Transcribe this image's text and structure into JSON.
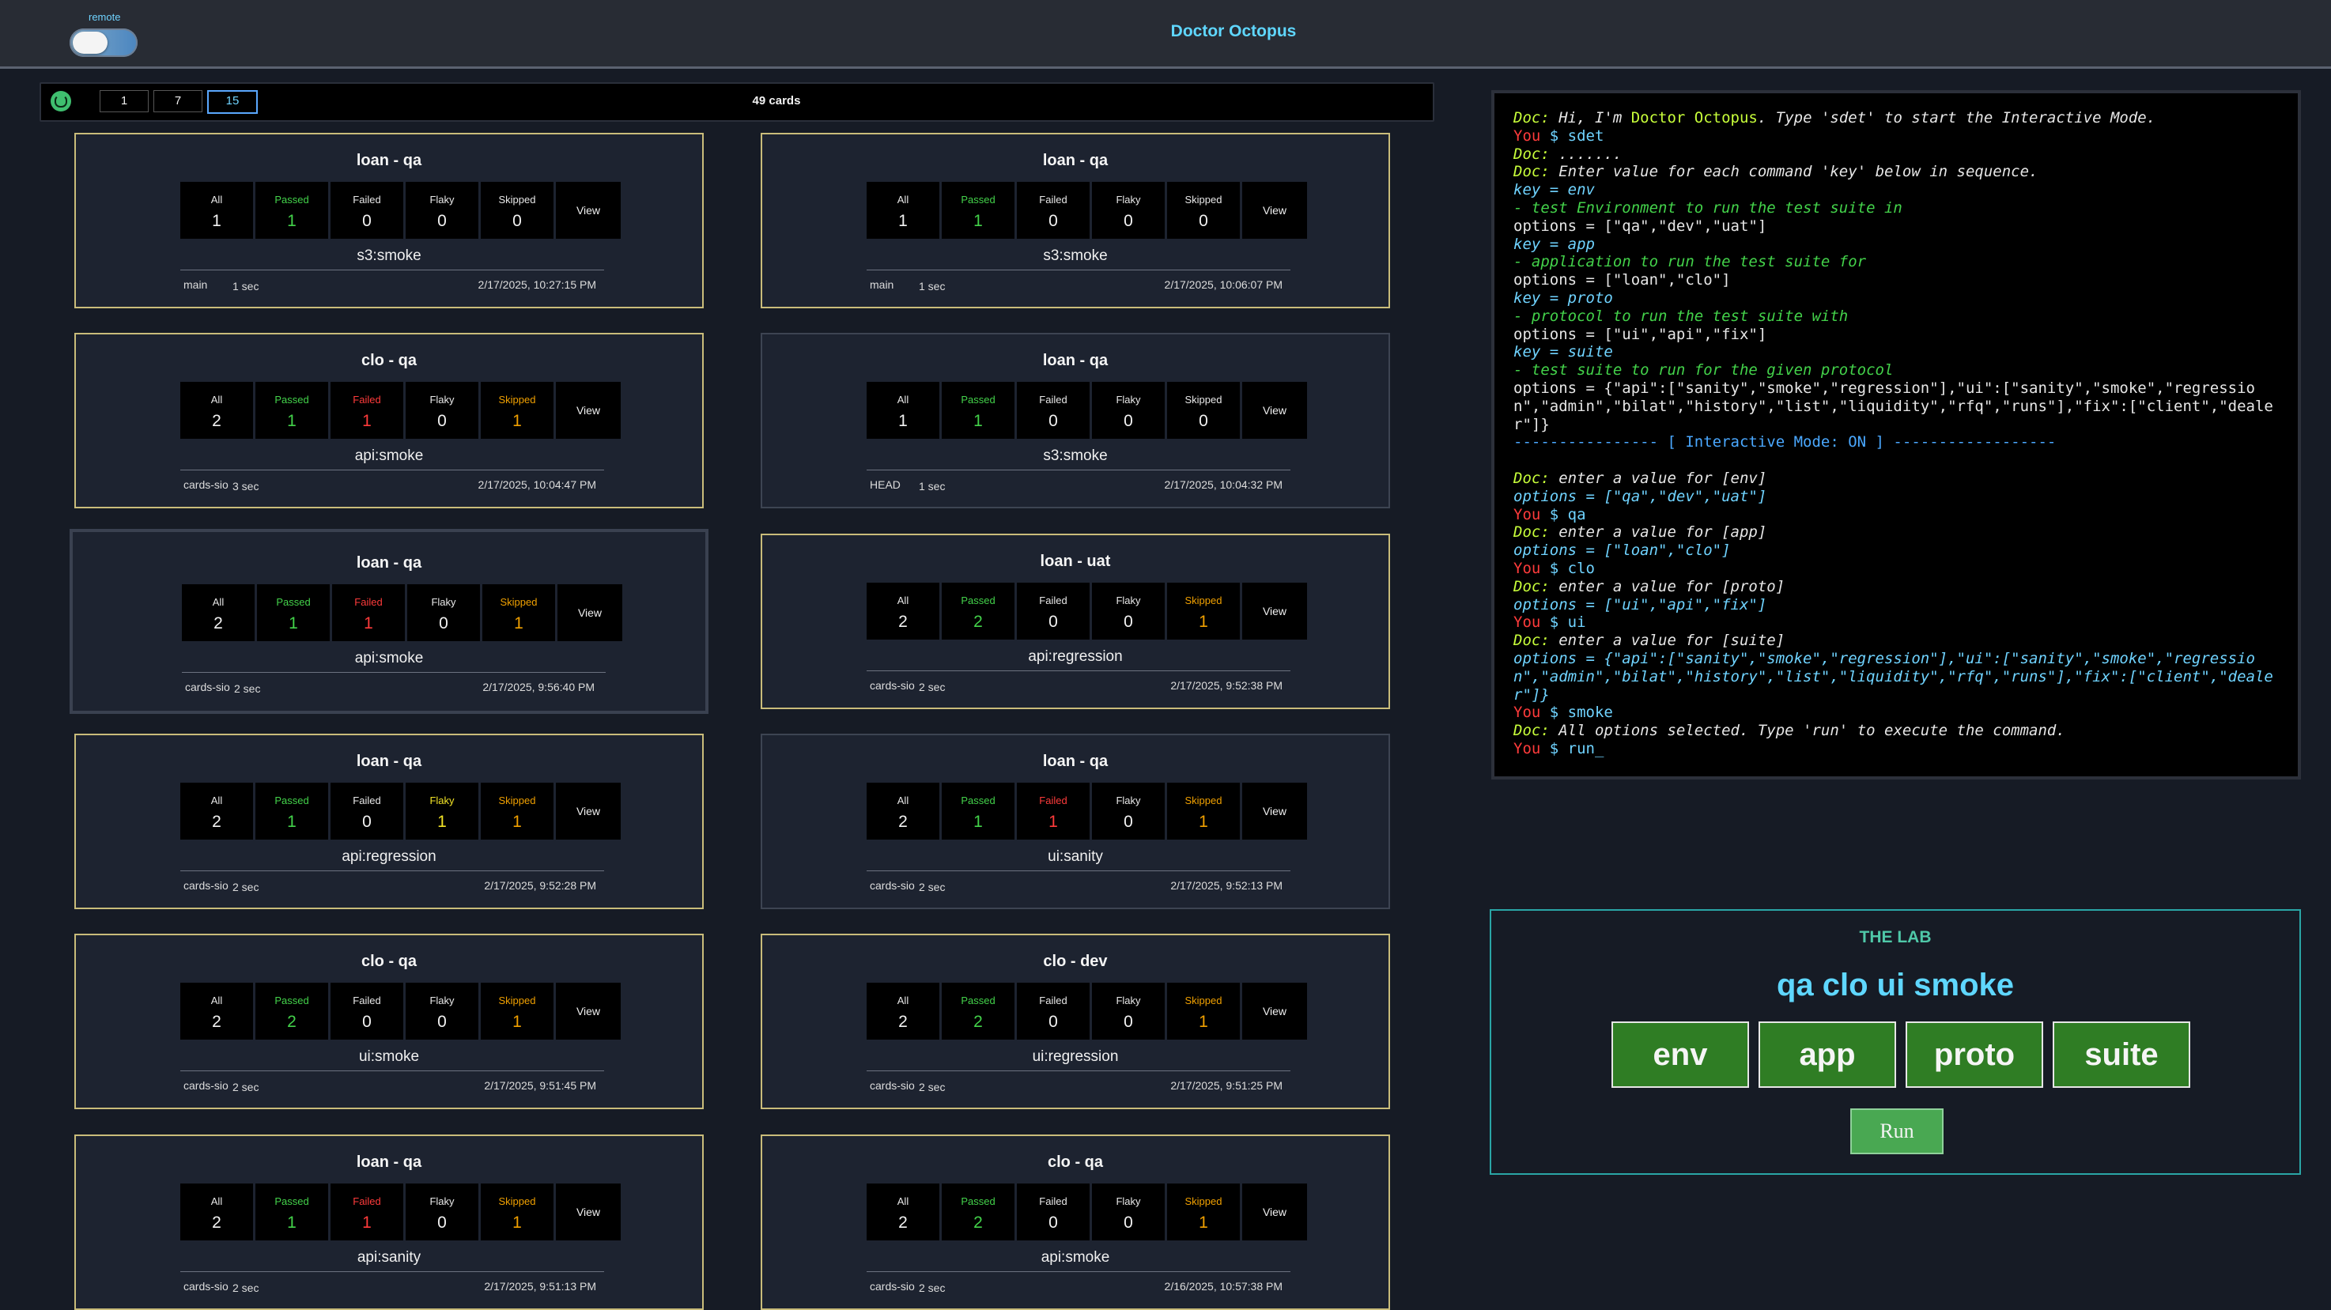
{
  "header": {
    "remote_label": "remote",
    "title": "Doctor Octopus"
  },
  "toolbar": {
    "pages": [
      "1",
      "7",
      "15"
    ],
    "active_page": "15",
    "card_count": "49 cards"
  },
  "stat_labels": {
    "all": "All",
    "passed": "Passed",
    "failed": "Failed",
    "flaky": "Flaky",
    "skipped": "Skipped",
    "view": "View"
  },
  "cards": [
    {
      "title": "loan - qa",
      "all": "1",
      "passed": "1",
      "failed": "0",
      "flaky": "0",
      "skipped": "0",
      "suite": "s3:smoke",
      "branch": "main",
      "duration": "1 sec",
      "timestamp": "2/17/2025, 10:27:15 PM"
    },
    {
      "title": "loan - qa",
      "all": "1",
      "passed": "1",
      "failed": "0",
      "flaky": "0",
      "skipped": "0",
      "suite": "s3:smoke",
      "branch": "main",
      "duration": "1 sec",
      "timestamp": "2/17/2025, 10:06:07 PM"
    },
    {
      "title": "clo - qa",
      "all": "2",
      "passed": "1",
      "failed": "1",
      "flaky": "0",
      "skipped": "1",
      "suite": "api:smoke",
      "branch": "cards-sio",
      "duration": "3 sec",
      "timestamp": "2/17/2025, 10:04:47 PM"
    },
    {
      "title": "loan - qa",
      "all": "1",
      "passed": "1",
      "failed": "0",
      "flaky": "0",
      "skipped": "0",
      "suite": "s3:smoke",
      "branch": "HEAD",
      "duration": "1 sec",
      "timestamp": "2/17/2025, 10:04:32 PM"
    },
    {
      "title": "loan - qa",
      "all": "2",
      "passed": "1",
      "failed": "1",
      "flaky": "0",
      "skipped": "1",
      "suite": "api:smoke",
      "branch": "cards-sio",
      "duration": "2 sec",
      "timestamp": "2/17/2025, 9:56:40 PM"
    },
    {
      "title": "loan - uat",
      "all": "2",
      "passed": "2",
      "failed": "0",
      "flaky": "0",
      "skipped": "1",
      "suite": "api:regression",
      "branch": "cards-sio",
      "duration": "2 sec",
      "timestamp": "2/17/2025, 9:52:38 PM"
    },
    {
      "title": "loan - qa",
      "all": "2",
      "passed": "1",
      "failed": "0",
      "flaky": "1",
      "skipped": "1",
      "suite": "api:regression",
      "branch": "cards-sio",
      "duration": "2 sec",
      "timestamp": "2/17/2025, 9:52:28 PM"
    },
    {
      "title": "loan - qa",
      "all": "2",
      "passed": "1",
      "failed": "1",
      "flaky": "0",
      "skipped": "1",
      "suite": "ui:sanity",
      "branch": "cards-sio",
      "duration": "2 sec",
      "timestamp": "2/17/2025, 9:52:13 PM"
    },
    {
      "title": "clo - qa",
      "all": "2",
      "passed": "2",
      "failed": "0",
      "flaky": "0",
      "skipped": "1",
      "suite": "ui:smoke",
      "branch": "cards-sio",
      "duration": "2 sec",
      "timestamp": "2/17/2025, 9:51:45 PM"
    },
    {
      "title": "clo - dev",
      "all": "2",
      "passed": "2",
      "failed": "0",
      "flaky": "0",
      "skipped": "1",
      "suite": "ui:regression",
      "branch": "cards-sio",
      "duration": "2 sec",
      "timestamp": "2/17/2025, 9:51:25 PM"
    },
    {
      "title": "loan - qa",
      "all": "2",
      "passed": "1",
      "failed": "1",
      "flaky": "0",
      "skipped": "1",
      "suite": "api:sanity",
      "branch": "cards-sio",
      "duration": "2 sec",
      "timestamp": "2/17/2025, 9:51:13 PM"
    },
    {
      "title": "clo - qa",
      "all": "2",
      "passed": "2",
      "failed": "0",
      "flaky": "0",
      "skipped": "1",
      "suite": "api:smoke",
      "branch": "cards-sio",
      "duration": "2 sec",
      "timestamp": "2/16/2025, 10:57:38 PM"
    }
  ],
  "terminal": {
    "lines": [
      {
        "parts": [
          {
            "style": "doc",
            "text": "Doc: "
          },
          {
            "style": "italic",
            "text": "Hi, I'm "
          },
          {
            "style": "hl",
            "text": "Doctor Octopus"
          },
          {
            "style": "italic",
            "text": ". Type 'sdet' to start the Interactive Mode."
          }
        ]
      },
      {
        "parts": [
          {
            "style": "you",
            "text": "You "
          },
          {
            "style": "cyan",
            "text": "$ sdet"
          }
        ]
      },
      {
        "parts": [
          {
            "style": "doc",
            "text": "Doc: "
          },
          {
            "style": "italic",
            "text": "......."
          }
        ]
      },
      {
        "parts": [
          {
            "style": "doc",
            "text": "Doc: "
          },
          {
            "style": "italic",
            "text": "Enter value for each command 'key' below in sequence."
          }
        ]
      },
      {
        "parts": [
          {
            "style": "key",
            "text": "key = env"
          }
        ]
      },
      {
        "parts": [
          {
            "style": "help",
            "text": "- test Environment to run the test suite in"
          }
        ]
      },
      {
        "parts": [
          {
            "style": "plain",
            "text": "options = [\"qa\",\"dev\",\"uat\"]"
          }
        ]
      },
      {
        "parts": [
          {
            "style": "key",
            "text": "key = app"
          }
        ]
      },
      {
        "parts": [
          {
            "style": "help",
            "text": "- application to run the test suite for"
          }
        ]
      },
      {
        "parts": [
          {
            "style": "plain",
            "text": "options = [\"loan\",\"clo\"]"
          }
        ]
      },
      {
        "parts": [
          {
            "style": "key",
            "text": "key = proto"
          }
        ]
      },
      {
        "parts": [
          {
            "style": "help",
            "text": "- protocol to run the test suite with"
          }
        ]
      },
      {
        "parts": [
          {
            "style": "plain",
            "text": "options = [\"ui\",\"api\",\"fix\"]"
          }
        ]
      },
      {
        "parts": [
          {
            "style": "key",
            "text": "key = suite"
          }
        ]
      },
      {
        "parts": [
          {
            "style": "help",
            "text": "- test suite to run for the given protocol"
          }
        ]
      },
      {
        "parts": [
          {
            "style": "plain",
            "text": "options = {\"api\":[\"sanity\",\"smoke\",\"regression\"],\"ui\":[\"sanity\",\"smoke\",\"regression\",\"admin\",\"bilat\",\"history\",\"list\",\"liquidity\",\"rfq\",\"runs\"],\"fix\":[\"client\",\"dealer\"]}"
          }
        ]
      },
      {
        "parts": [
          {
            "style": "interactive",
            "text": "---------------- [ Interactive Mode: ON ] ------------------"
          }
        ]
      },
      {
        "parts": [
          {
            "style": "plain",
            "text": ""
          }
        ]
      },
      {
        "parts": [
          {
            "style": "doc",
            "text": "Doc: "
          },
          {
            "style": "italic",
            "text": "enter a value for [env]"
          }
        ]
      },
      {
        "parts": [
          {
            "style": "key",
            "text": "options = [\"qa\",\"dev\",\"uat\"]"
          }
        ]
      },
      {
        "parts": [
          {
            "style": "you",
            "text": "You "
          },
          {
            "style": "cyan",
            "text": "$ qa"
          }
        ]
      },
      {
        "parts": [
          {
            "style": "doc",
            "text": "Doc: "
          },
          {
            "style": "italic",
            "text": "enter a value for [app]"
          }
        ]
      },
      {
        "parts": [
          {
            "style": "key",
            "text": "options = [\"loan\",\"clo\"]"
          }
        ]
      },
      {
        "parts": [
          {
            "style": "you",
            "text": "You "
          },
          {
            "style": "cyan",
            "text": "$ clo"
          }
        ]
      },
      {
        "parts": [
          {
            "style": "doc",
            "text": "Doc: "
          },
          {
            "style": "italic",
            "text": "enter a value for [proto]"
          }
        ]
      },
      {
        "parts": [
          {
            "style": "key",
            "text": "options = [\"ui\",\"api\",\"fix\"]"
          }
        ]
      },
      {
        "parts": [
          {
            "style": "you",
            "text": "You "
          },
          {
            "style": "cyan",
            "text": "$ ui"
          }
        ]
      },
      {
        "parts": [
          {
            "style": "doc",
            "text": "Doc: "
          },
          {
            "style": "italic",
            "text": "enter a value for [suite]"
          }
        ]
      },
      {
        "parts": [
          {
            "style": "key",
            "text": "options = {\"api\":[\"sanity\",\"smoke\",\"regression\"],\"ui\":[\"sanity\",\"smoke\",\"regression\",\"admin\",\"bilat\",\"history\",\"list\",\"liquidity\",\"rfq\",\"runs\"],\"fix\":[\"client\",\"dealer\"]}"
          }
        ]
      },
      {
        "parts": [
          {
            "style": "you",
            "text": "You "
          },
          {
            "style": "cyan",
            "text": "$ smoke"
          }
        ]
      },
      {
        "parts": [
          {
            "style": "doc",
            "text": "Doc: "
          },
          {
            "style": "italic",
            "text": "All options selected. Type 'run' to execute the command."
          }
        ]
      },
      {
        "parts": [
          {
            "style": "you",
            "text": "You "
          },
          {
            "style": "cyan",
            "text": "$ run_"
          }
        ]
      }
    ]
  },
  "lab": {
    "title": "THE LAB",
    "command": "qa clo ui smoke",
    "buttons": [
      "env",
      "app",
      "proto",
      "suite"
    ],
    "run_label": "Run"
  },
  "colors": {
    "accent": "#5fd7ff",
    "passed": "#43d24a",
    "failed": "#ff3b3b",
    "flaky": "#f0e226",
    "skipped": "#f0a000",
    "lab_button": "#2f7d24",
    "card_border": "#c9bc7a"
  }
}
